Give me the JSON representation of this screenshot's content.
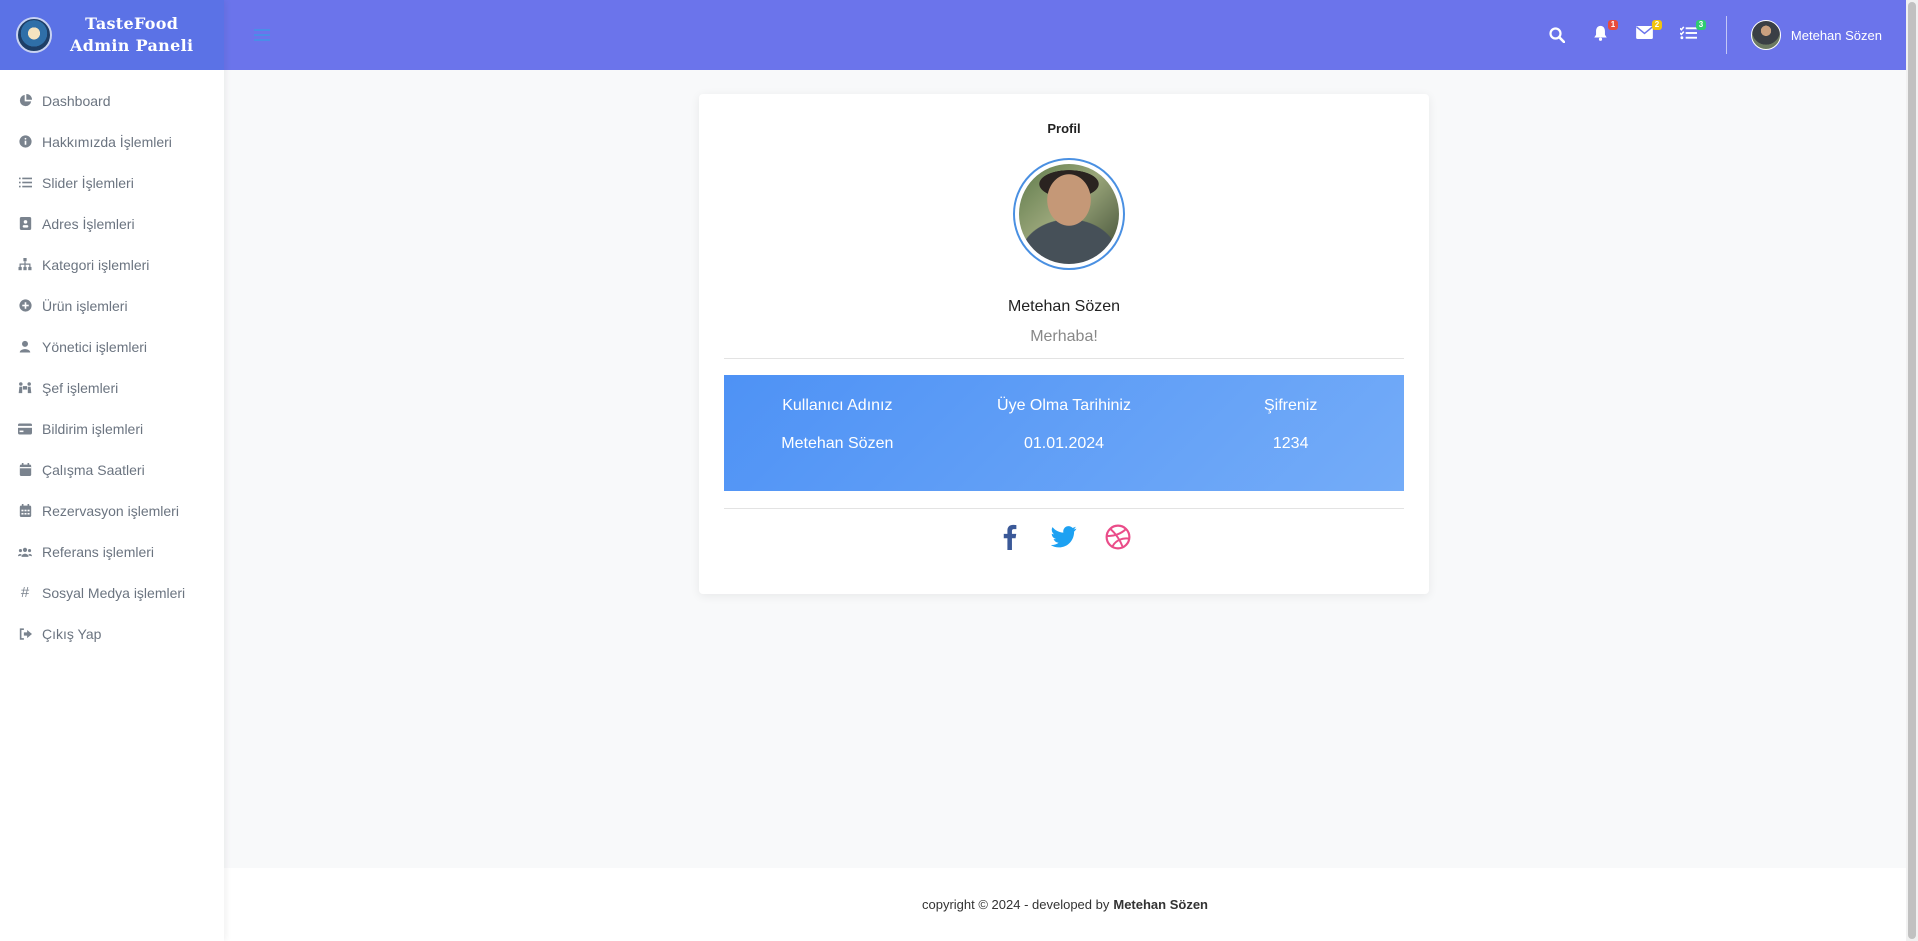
{
  "brand": {
    "line1": "TasteFood",
    "line2": "Admin Paneli"
  },
  "sidebar": {
    "items": [
      {
        "label": "Dashboard",
        "icon": "chart-pie-icon"
      },
      {
        "label": "Hakkımızda İşlemleri",
        "icon": "info-circle-icon"
      },
      {
        "label": "Slider İşlemleri",
        "icon": "list-icon"
      },
      {
        "label": "Adres İşlemleri",
        "icon": "address-card-icon"
      },
      {
        "label": "Kategori işlemleri",
        "icon": "sitemap-icon"
      },
      {
        "label": "Ürün işlemleri",
        "icon": "plus-circle-icon"
      },
      {
        "label": "Yönetici işlemleri",
        "icon": "user-icon"
      },
      {
        "label": "Şef işlemleri",
        "icon": "people-carry-icon"
      },
      {
        "label": "Bildirim işlemleri",
        "icon": "credit-card-icon"
      },
      {
        "label": "Çalışma Saatleri",
        "icon": "calendar-icon"
      },
      {
        "label": "Rezervasyon işlemleri",
        "icon": "calendar-alt-icon"
      },
      {
        "label": "Referans işlemleri",
        "icon": "users-icon"
      },
      {
        "label": "Sosyal Medya işlemleri",
        "icon": "hashtag-icon"
      },
      {
        "label": "Çıkış Yap",
        "icon": "sign-out-icon"
      }
    ]
  },
  "topbar": {
    "notifications_badge": "1",
    "messages_badge": "2",
    "tasks_badge": "3",
    "user_name": "Metehan Sözen"
  },
  "profile": {
    "title": "Profil",
    "name": "Metehan Sözen",
    "greeting": "Merhaba!",
    "info": [
      {
        "label": "Kullanıcı Adınız",
        "value": "Metehan Sözen"
      },
      {
        "label": "Üye Olma Tarihiniz",
        "value": "01.01.2024"
      },
      {
        "label": "Şifreniz",
        "value": "1234"
      }
    ]
  },
  "footer": {
    "text": "copyright © 2024 - developed by",
    "author": "Metehan Sözen"
  },
  "colors": {
    "brand_bg": "#5b72e6",
    "topbar_bg": "#6b74eb",
    "info_gradient_start": "#4e92f5",
    "info_gradient_end": "#74acf8",
    "facebook": "#3b5998",
    "twitter": "#1da1f2",
    "dribbble": "#ea4c89",
    "badge_red": "#e74c3c",
    "badge_yellow": "#f1c40f",
    "badge_green": "#2ecc71"
  }
}
